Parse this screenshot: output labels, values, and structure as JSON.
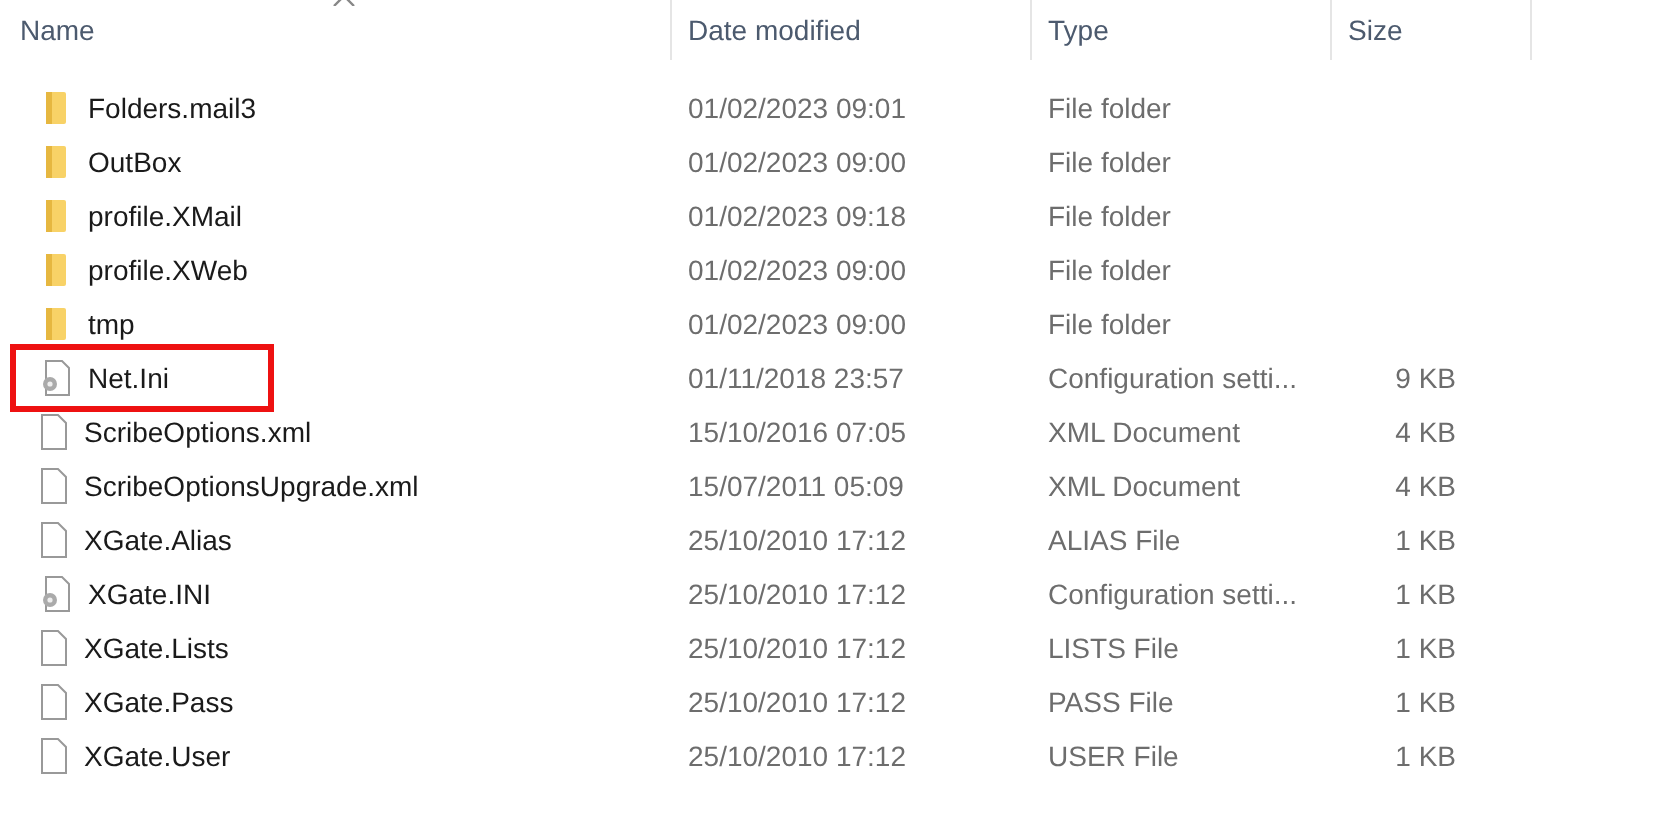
{
  "columns": [
    {
      "label": "Name",
      "sorted": true
    },
    {
      "label": "Date modified",
      "sorted": false
    },
    {
      "label": "Type",
      "sorted": false
    },
    {
      "label": "Size",
      "sorted": false
    }
  ],
  "rows": [
    {
      "kind": "folder",
      "name": "Folders.mail3",
      "date": "01/02/2023 09:01",
      "type": "File folder",
      "highlighted": false
    },
    {
      "kind": "folder",
      "name": "OutBox",
      "date": "01/02/2023 09:00",
      "type": "File folder",
      "highlighted": false
    },
    {
      "kind": "folder",
      "name": "profile.XMail",
      "date": "01/02/2023 09:18",
      "type": "File folder",
      "highlighted": false
    },
    {
      "kind": "folder",
      "name": "profile.XWeb",
      "date": "01/02/2023 09:00",
      "type": "File folder",
      "highlighted": false
    },
    {
      "kind": "folder",
      "name": "tmp",
      "date": "01/02/2023 09:00",
      "type": "File folder",
      "highlighted": false
    },
    {
      "kind": "config",
      "name": "Net.Ini",
      "date": "01/11/2018 23:57",
      "type": "Configuration setti...",
      "size": "9 KB",
      "highlighted": true
    },
    {
      "kind": "file",
      "name": "ScribeOptions.xml",
      "date": "15/10/2016 07:05",
      "type": "XML Document",
      "size": "4 KB",
      "highlighted": false
    },
    {
      "kind": "file",
      "name": "ScribeOptionsUpgrade.xml",
      "date": "15/07/2011 05:09",
      "type": "XML Document",
      "size": "4 KB",
      "highlighted": false
    },
    {
      "kind": "file",
      "name": "XGate.Alias",
      "date": "25/10/2010 17:12",
      "type": "ALIAS File",
      "size": "1 KB",
      "highlighted": false
    },
    {
      "kind": "config",
      "name": "XGate.INI",
      "date": "25/10/2010 17:12",
      "type": "Configuration setti...",
      "size": "1 KB",
      "highlighted": false
    },
    {
      "kind": "file",
      "name": "XGate.Lists",
      "date": "25/10/2010 17:12",
      "type": "LISTS File",
      "size": "1 KB",
      "highlighted": false
    },
    {
      "kind": "file",
      "name": "XGate.Pass",
      "date": "25/10/2010 17:12",
      "type": "PASS File",
      "size": "1 KB",
      "highlighted": false
    },
    {
      "kind": "file",
      "name": "XGate.User",
      "date": "25/10/2010 17:12",
      "type": "USER File",
      "size": "1 KB",
      "highlighted": false
    }
  ]
}
